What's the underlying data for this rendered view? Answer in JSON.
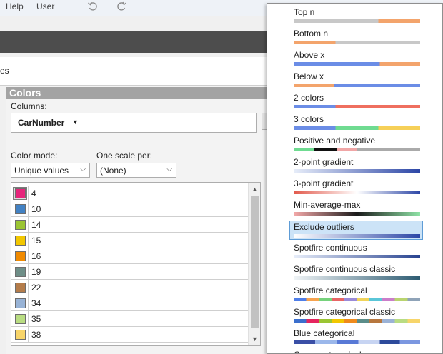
{
  "menu": {
    "help_label": "Help",
    "user_label": "User"
  },
  "panel": {
    "title": "Colors",
    "columns_label": "Columns:",
    "column_chip": "CarNumber",
    "color_mode_label": "Color mode:",
    "color_mode_value": "Unique values",
    "scale_label": "One scale per:",
    "scale_value": "(None)",
    "strip_text": "es"
  },
  "values": [
    {
      "label": "4",
      "color": "#e6257b",
      "selected": true
    },
    {
      "label": "10",
      "color": "#4382c4"
    },
    {
      "label": "14",
      "color": "#9bc533"
    },
    {
      "label": "15",
      "color": "#f2c700"
    },
    {
      "label": "16",
      "color": "#f08a00"
    },
    {
      "label": "19",
      "color": "#6e8e87"
    },
    {
      "label": "22",
      "color": "#b47c4a"
    },
    {
      "label": "34",
      "color": "#98b3d6"
    },
    {
      "label": "35",
      "color": "#b9dd82"
    },
    {
      "label": "38",
      "color": "#f8d56a"
    }
  ],
  "colors": {
    "selection_bg": "#cce3f7",
    "selection_border": "#5e9cd6",
    "panel_header": "#a3a3a3"
  },
  "schemes": [
    {
      "label": "Top n",
      "selected": false,
      "bar": [
        [
          "#c8c8c8",
          67
        ],
        [
          "#f3a46c",
          33
        ]
      ]
    },
    {
      "label": "Bottom n",
      "selected": false,
      "bar": [
        [
          "#f3a46c",
          33
        ],
        [
          "#c8c8c8",
          67
        ]
      ]
    },
    {
      "label": "Above x",
      "selected": false,
      "bar": [
        [
          "#6b8de6",
          68
        ],
        [
          "#f3a46c",
          32
        ]
      ]
    },
    {
      "label": "Below x",
      "selected": false,
      "bar": [
        [
          "#f3a46c",
          32
        ],
        [
          "#6b8de6",
          68
        ]
      ]
    },
    {
      "label": "2 colors",
      "selected": false,
      "bar": [
        [
          "#6b8de6",
          33
        ],
        [
          "#ef6f5f",
          67
        ]
      ]
    },
    {
      "label": "3 colors",
      "selected": false,
      "bar": [
        [
          "#6b8de6",
          33
        ],
        [
          "#6fdb91",
          34
        ],
        [
          "#f6d058",
          33
        ]
      ]
    },
    {
      "label": "Positive and negative",
      "selected": false,
      "bar": [
        [
          "#6fdb91",
          16
        ],
        [
          "#111111",
          18
        ],
        [
          "#f0a6a6",
          16
        ],
        [
          "#aaaaaa",
          50
        ]
      ]
    },
    {
      "label": "2-point gradient",
      "selected": false,
      "gradient": [
        "#e7edf9",
        "#2c46a6"
      ]
    },
    {
      "label": "3-point gradient",
      "selected": false,
      "gradient": [
        "#e25a4c",
        "#ffffff",
        "#2c46a6"
      ]
    },
    {
      "label": "Min-average-max",
      "selected": false,
      "gradient": [
        "#f4a9a9",
        "#1a1a1a",
        "#8fe3a6"
      ]
    },
    {
      "label": "Exclude outliers",
      "selected": true,
      "gradient": [
        "#ffffff",
        "#2c46a6"
      ]
    },
    {
      "label": "Spotfire continuous",
      "selected": false,
      "gradient": [
        "#e7edf9",
        "#27428f"
      ]
    },
    {
      "label": "Spotfire continuous classic",
      "selected": false,
      "gradient": [
        "#f0f4f6",
        "#2d5b72"
      ]
    },
    {
      "label": "Spotfire categorical",
      "selected": false,
      "bar": [
        [
          "#4f7ee8",
          10
        ],
        [
          "#f7a34f",
          10
        ],
        [
          "#76d27c",
          10
        ],
        [
          "#e86565",
          10
        ],
        [
          "#9a8bd8",
          10
        ],
        [
          "#f0d45a",
          10
        ],
        [
          "#5ac6d8",
          10
        ],
        [
          "#ca7dc9",
          10
        ],
        [
          "#b9d46f",
          10
        ],
        [
          "#8fa3b8",
          10
        ]
      ]
    },
    {
      "label": "Spotfire categorical classic",
      "selected": false,
      "bar": [
        [
          "#3b6fcd",
          10
        ],
        [
          "#e5255f",
          10
        ],
        [
          "#9bc533",
          10
        ],
        [
          "#f2c700",
          10
        ],
        [
          "#ef8a1c",
          10
        ],
        [
          "#5b8d89",
          10
        ],
        [
          "#b7773e",
          10
        ],
        [
          "#9bb2d6",
          10
        ],
        [
          "#b9dc82",
          10
        ],
        [
          "#f7d56a",
          10
        ]
      ]
    },
    {
      "label": "Blue categorical",
      "selected": false,
      "bar": [
        [
          "#3a4fa6",
          17
        ],
        [
          "#9bb7ea",
          17
        ],
        [
          "#5879d6",
          17
        ],
        [
          "#c7d4f2",
          17
        ],
        [
          "#2d4a9b",
          16
        ],
        [
          "#7b97e0",
          16
        ]
      ]
    },
    {
      "label": "Green categorical",
      "selected": false,
      "bar": [
        [
          "#2f9a47",
          50
        ],
        [
          "#9ad89c",
          50
        ]
      ]
    }
  ]
}
